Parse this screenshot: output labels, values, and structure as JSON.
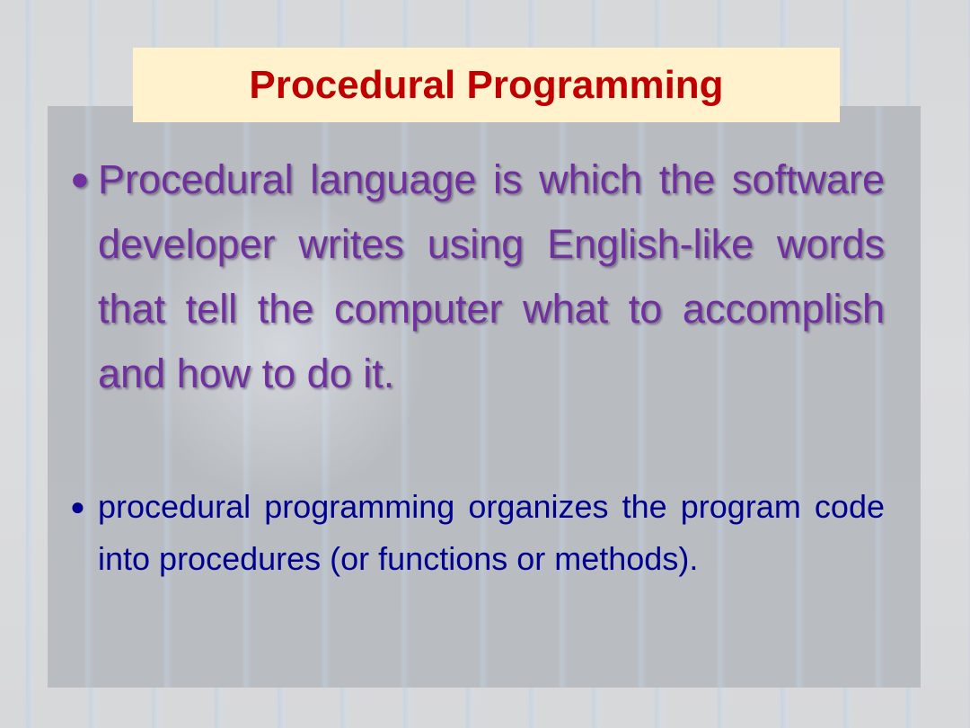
{
  "slide": {
    "title": "Procedural Programming",
    "bullets": [
      {
        "icon": "bullet-dot-icon",
        "glyph": "●",
        "text": "Procedural language is which the software developer writes using English-like words that tell the computer what to accomplish and how to do it.",
        "color": "#7030A0"
      },
      {
        "icon": "bullet-dot-icon",
        "glyph": "●",
        "text": "procedural programming organizes the program code into procedures (or functions or methods).",
        "color": "#000090"
      }
    ]
  },
  "colors": {
    "title_text": "#C00000",
    "title_background": "#FFF2CC"
  }
}
